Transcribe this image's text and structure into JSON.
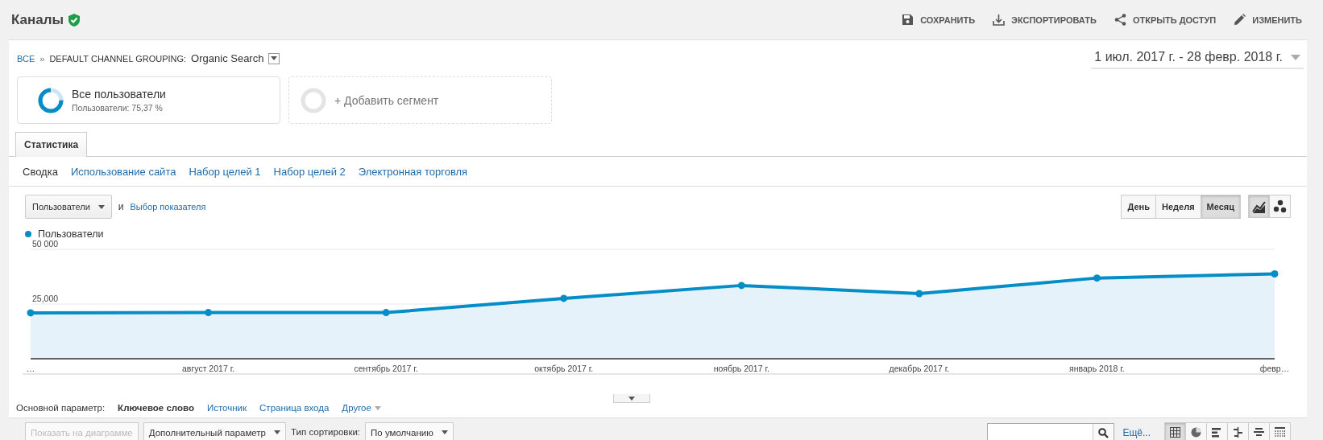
{
  "header": {
    "title": "Каналы",
    "actions": [
      {
        "label": "СОХРАНИТЬ"
      },
      {
        "label": "ЭКСПОРТИРОВАТЬ"
      },
      {
        "label": "ОТКРЫТЬ ДОСТУП"
      },
      {
        "label": "ИЗМЕНИТЬ"
      }
    ]
  },
  "breadcrumb": {
    "root": "ВСЕ",
    "separator": "»",
    "dimension": "DEFAULT CHANNEL GROUPING:",
    "value": "Organic Search"
  },
  "date_range": "1 июл. 2017 г. - 28 февр. 2018 г.",
  "segments": [
    {
      "kind": "segment",
      "name": "Все пользователи",
      "detail": "Пользователи: 75,37 %"
    },
    {
      "kind": "add",
      "name": "+ Добавить сегмент"
    }
  ],
  "tabs": [
    {
      "label": "Статистика",
      "selected": true
    }
  ],
  "subtabs": [
    {
      "label": "Сводка",
      "selected": true
    },
    {
      "label": "Использование сайта",
      "selected": false
    },
    {
      "label": "Набор целей 1",
      "selected": false
    },
    {
      "label": "Набор целей 2",
      "selected": false
    },
    {
      "label": "Электронная торговля",
      "selected": false
    }
  ],
  "metric_select": "Пользователи",
  "metric_and": "и",
  "metric_link": "Выбор показателя",
  "periods": [
    {
      "label": "День",
      "selected": false
    },
    {
      "label": "Неделя",
      "selected": false
    },
    {
      "label": "Месяц",
      "selected": true
    }
  ],
  "chart_modes": [
    {
      "selected": true
    },
    {
      "selected": false
    }
  ],
  "chart_data": {
    "type": "area",
    "categories": [
      "…",
      "август 2017 г.",
      "сентябрь 2017 г.",
      "октябрь 2017 г.",
      "ноябрь 2017 г.",
      "декабрь 2017 г.",
      "январь 2018 г.",
      "февр…"
    ],
    "series": [
      {
        "name": "Пользователи",
        "color": "#058dc7",
        "values": [
          21000,
          21100,
          21100,
          27600,
          33500,
          29800,
          36900,
          38800
        ]
      }
    ],
    "ylim": [
      0,
      50000
    ],
    "yticks": [
      {
        "value": 25000,
        "label": "25,000"
      },
      {
        "value": 50000,
        "label": "50 000"
      }
    ]
  },
  "dimension_bar": {
    "label": "Основной параметр:",
    "options": [
      {
        "label": "Ключевое слово",
        "selected": true
      },
      {
        "label": "Источник",
        "selected": false
      },
      {
        "label": "Страница входа",
        "selected": false
      },
      {
        "label": "Другое",
        "selected": false
      }
    ]
  },
  "toolbar": {
    "plot_button": {
      "label": "Показать на диаграмме",
      "disabled": true
    },
    "secondary": "Дополнительный параметр",
    "sort_label": "Тип сортировки:",
    "sort_value": "По умолчанию",
    "more": "Ещё...",
    "views": [
      {
        "selected": true
      },
      {
        "selected": false
      },
      {
        "selected": false
      },
      {
        "selected": false
      },
      {
        "selected": false
      },
      {
        "selected": false
      }
    ]
  }
}
